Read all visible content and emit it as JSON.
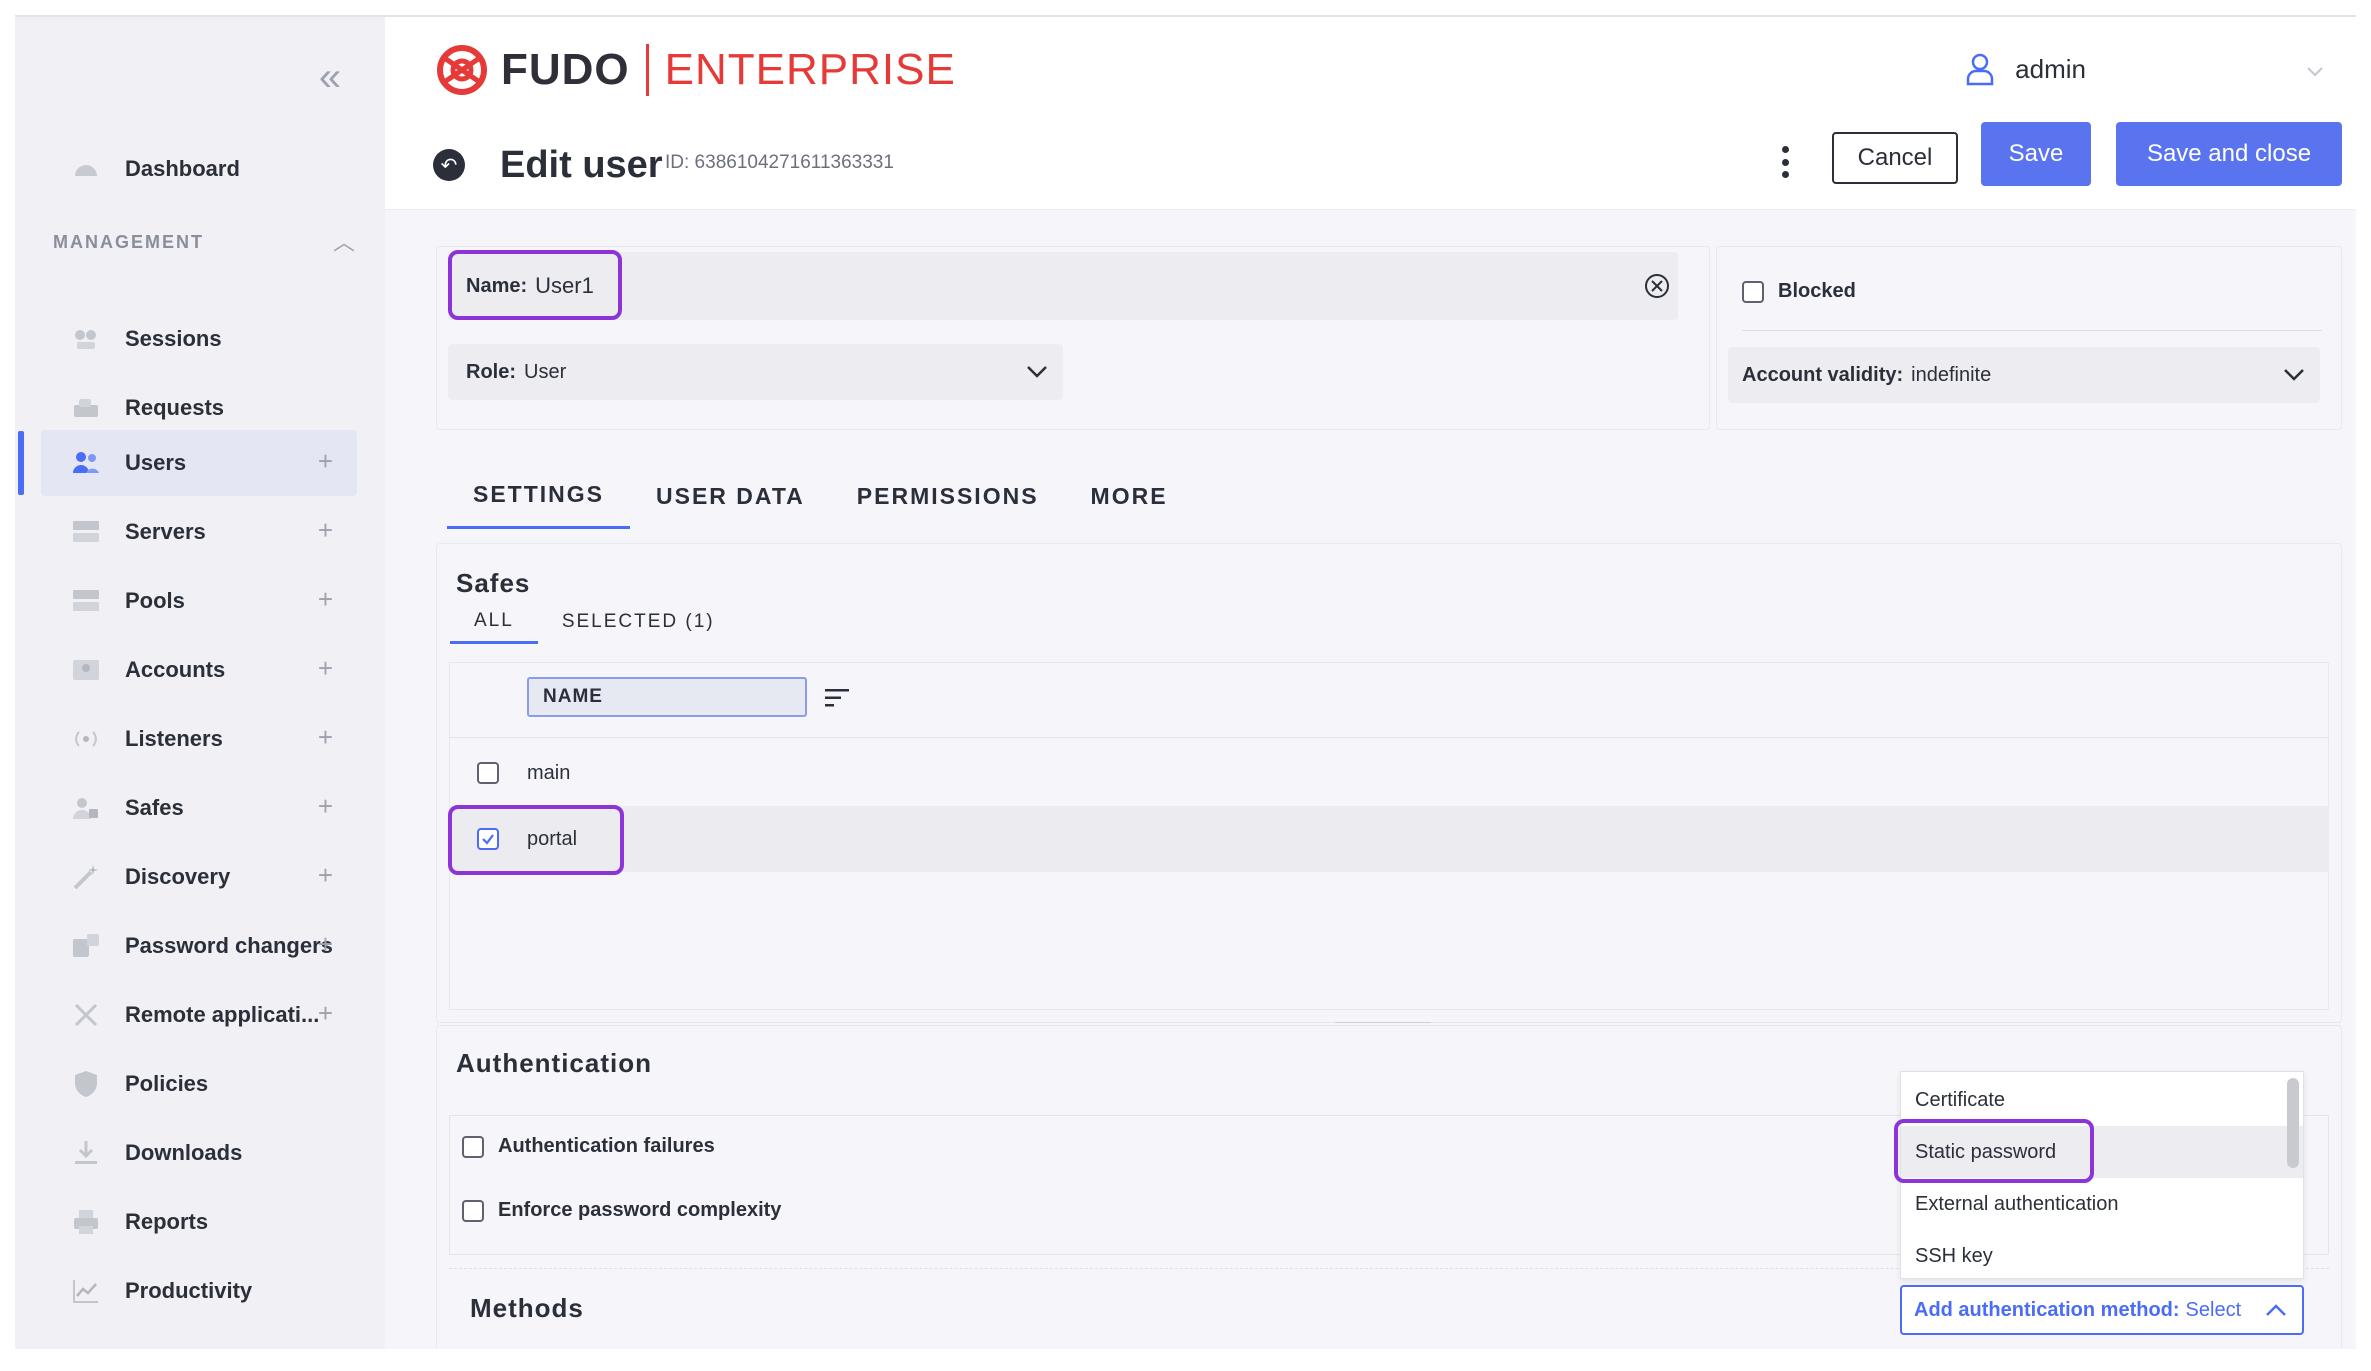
{
  "sidebar": {
    "dashboard": "Dashboard",
    "management_label": "MANAGEMENT",
    "items": [
      {
        "label": "Sessions",
        "plus": ""
      },
      {
        "label": "Requests",
        "plus": ""
      },
      {
        "label": "Users",
        "plus": "+"
      },
      {
        "label": "Servers",
        "plus": "+"
      },
      {
        "label": "Pools",
        "plus": "+"
      },
      {
        "label": "Accounts",
        "plus": "+"
      },
      {
        "label": "Listeners",
        "plus": "+"
      },
      {
        "label": "Safes",
        "plus": "+"
      },
      {
        "label": "Discovery",
        "plus": "+"
      },
      {
        "label": "Password changers",
        "plus": "+"
      },
      {
        "label": "Remote applicati...",
        "plus": "+"
      },
      {
        "label": "Policies",
        "plus": ""
      },
      {
        "label": "Downloads",
        "plus": ""
      },
      {
        "label": "Reports",
        "plus": ""
      },
      {
        "label": "Productivity",
        "plus": ""
      }
    ]
  },
  "header": {
    "logo_fudo": "FUDO",
    "logo_enterprise": "ENTERPRISE",
    "username": "admin",
    "title": "Edit user",
    "id_text": "ID: 6386104271611363331",
    "cancel": "Cancel",
    "save": "Save",
    "save_close": "Save and close"
  },
  "form": {
    "name_label": "Name:",
    "name_value": "User1",
    "role_label": "Role:",
    "role_value": "User",
    "blocked_label": "Blocked",
    "validity_label": "Account validity:",
    "validity_value": "indefinite"
  },
  "tabs": [
    "SETTINGS",
    "USER DATA",
    "PERMISSIONS",
    "MORE"
  ],
  "safes": {
    "title": "Safes",
    "subtabs": [
      "ALL",
      "SELECTED (1)"
    ],
    "column": "NAME",
    "rows": [
      {
        "name": "main",
        "checked": false
      },
      {
        "name": "portal",
        "checked": true
      }
    ]
  },
  "authentication": {
    "title": "Authentication",
    "failures": "Authentication failures",
    "complexity": "Enforce password complexity",
    "methods_title": "Methods",
    "add_label": "Add authentication method:",
    "add_value": "Select",
    "options": [
      "Certificate",
      "Static password",
      "External authentication",
      "SSH key"
    ]
  },
  "colors": {
    "accent": "#4a6cf7",
    "highlight": "#8b35d8",
    "brand_red": "#e53a38"
  }
}
